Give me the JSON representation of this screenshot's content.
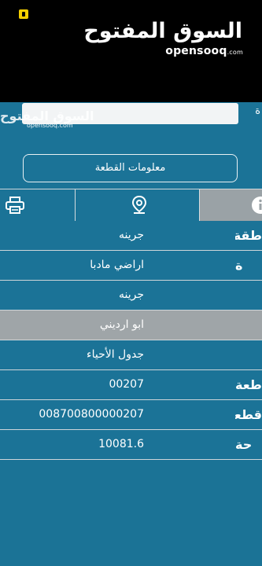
{
  "brand": {
    "arabic": "السوق المفتوح",
    "english": "opensooq",
    "domain": ".com"
  },
  "header": {
    "watermark_arabic": "السوق المفتوح",
    "watermark_english": "opensooq.com",
    "info_button_label": "معلومات القطعة"
  },
  "tabs": [
    {
      "name": "print",
      "icon": "printer-icon"
    },
    {
      "name": "location",
      "icon": "map-pin-icon"
    },
    {
      "name": "info",
      "icon": "info-icon",
      "selected": true
    }
  ],
  "rows": [
    {
      "label": "طقة",
      "value": "جرينه"
    },
    {
      "label": "ة",
      "value": "اراضي مادبا"
    },
    {
      "label": "",
      "value": "جرينه"
    },
    {
      "label": "",
      "value": "ابو ارديني"
    },
    {
      "label": "",
      "value": "جدول الأحياء"
    },
    {
      "label": "طعة",
      "value": "00207"
    },
    {
      "label": "قطعة",
      "value": "008700800000207"
    },
    {
      "label": "حة",
      "value": "10081.6"
    }
  ],
  "colors": {
    "primary": "#1b7397",
    "highlight": "#9fa5a8",
    "badge": "#f5d000"
  }
}
